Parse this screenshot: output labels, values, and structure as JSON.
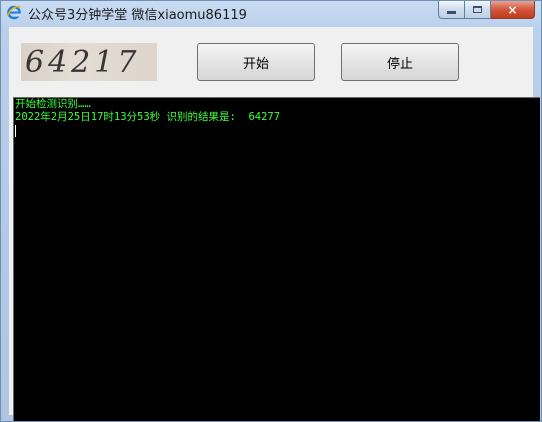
{
  "window": {
    "title": "公众号3分钟学堂 微信xiaomu86119",
    "close_glyph": "×"
  },
  "captcha": {
    "text": "64217"
  },
  "buttons": {
    "start_label": "开始",
    "stop_label": "停止"
  },
  "console": {
    "lines": [
      "开始检测识别……",
      "2022年2月25日17时13分53秒 识别的结果是:  64277"
    ]
  },
  "colors": {
    "console_text": "#3cff3c",
    "console_bg": "#000000"
  }
}
